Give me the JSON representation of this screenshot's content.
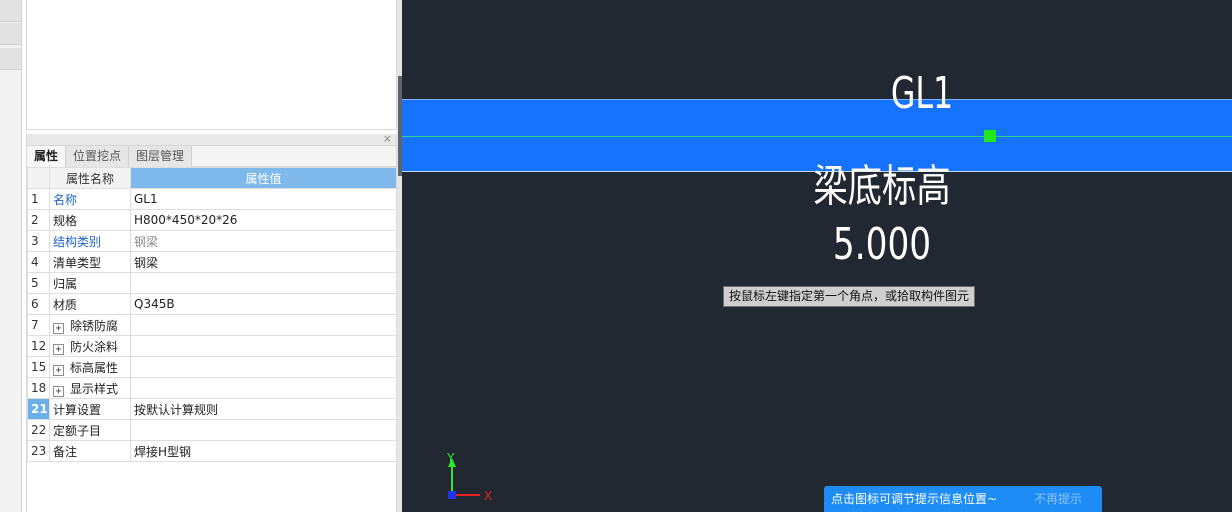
{
  "property_panel": {
    "close_glyph": "×",
    "tabs": [
      "属性",
      "位置挖点",
      "图层管理"
    ],
    "header": {
      "name": "属性名称",
      "value": "属性值"
    },
    "rows": [
      {
        "num": "1",
        "name": "名称",
        "value": "GL1"
      },
      {
        "num": "2",
        "name": "规格",
        "value": "H800*450*20*26"
      },
      {
        "num": "3",
        "name": "结构类别",
        "value": "钢梁"
      },
      {
        "num": "4",
        "name": "清单类型",
        "value": "钢梁"
      },
      {
        "num": "5",
        "name": "归属",
        "value": ""
      },
      {
        "num": "6",
        "name": "材质",
        "value": "Q345B"
      },
      {
        "num": "7",
        "name": "除锈防腐",
        "value": ""
      },
      {
        "num": "12",
        "name": "防火涂料",
        "value": ""
      },
      {
        "num": "15",
        "name": "标高属性",
        "value": ""
      },
      {
        "num": "18",
        "name": "显示样式",
        "value": ""
      },
      {
        "num": "21",
        "name": "计算设置",
        "value": "按默认计算规则"
      },
      {
        "num": "22",
        "name": "定额子目",
        "value": ""
      },
      {
        "num": "23",
        "name": "备注",
        "value": "焊接H型钢"
      }
    ]
  },
  "canvas": {
    "beam_label": "GL1",
    "beam_elevation_label": "梁底标高5.000",
    "tooltip": "按鼠标左键指定第一个角点，或拾取构件图元",
    "axis_x": "X",
    "axis_y": "Y",
    "colors": {
      "background": "#212832",
      "beam": "#1673ff",
      "grip": "#22e81a"
    }
  },
  "hint_bar": {
    "message": "点击图标可调节提示信息位置~",
    "dismiss": "不再提示"
  }
}
